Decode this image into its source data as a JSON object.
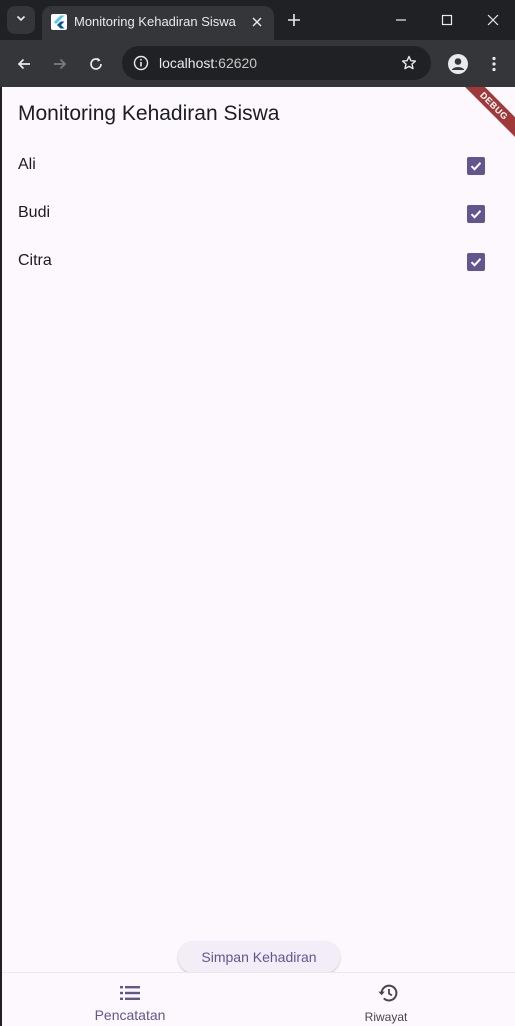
{
  "browser": {
    "tab_title": "Monitoring Kehadiran Siswa",
    "url_host": "localhost",
    "url_port": ":62620"
  },
  "app": {
    "title": "Monitoring Kehadiran Siswa",
    "debug_banner": "DEBUG",
    "students": [
      {
        "name": "Ali",
        "present": true
      },
      {
        "name": "Budi",
        "present": true
      },
      {
        "name": "Citra",
        "present": true
      }
    ],
    "save_button": "Simpan Kehadiran",
    "bottom_nav": [
      {
        "label": "Pencatatan",
        "icon": "list-icon",
        "selected": true
      },
      {
        "label": "Riwayat",
        "icon": "history-icon",
        "selected": false
      }
    ]
  },
  "colors": {
    "accent": "#65558f",
    "app_background": "#fdf7fe",
    "debug_banner": "#a03a3a"
  }
}
